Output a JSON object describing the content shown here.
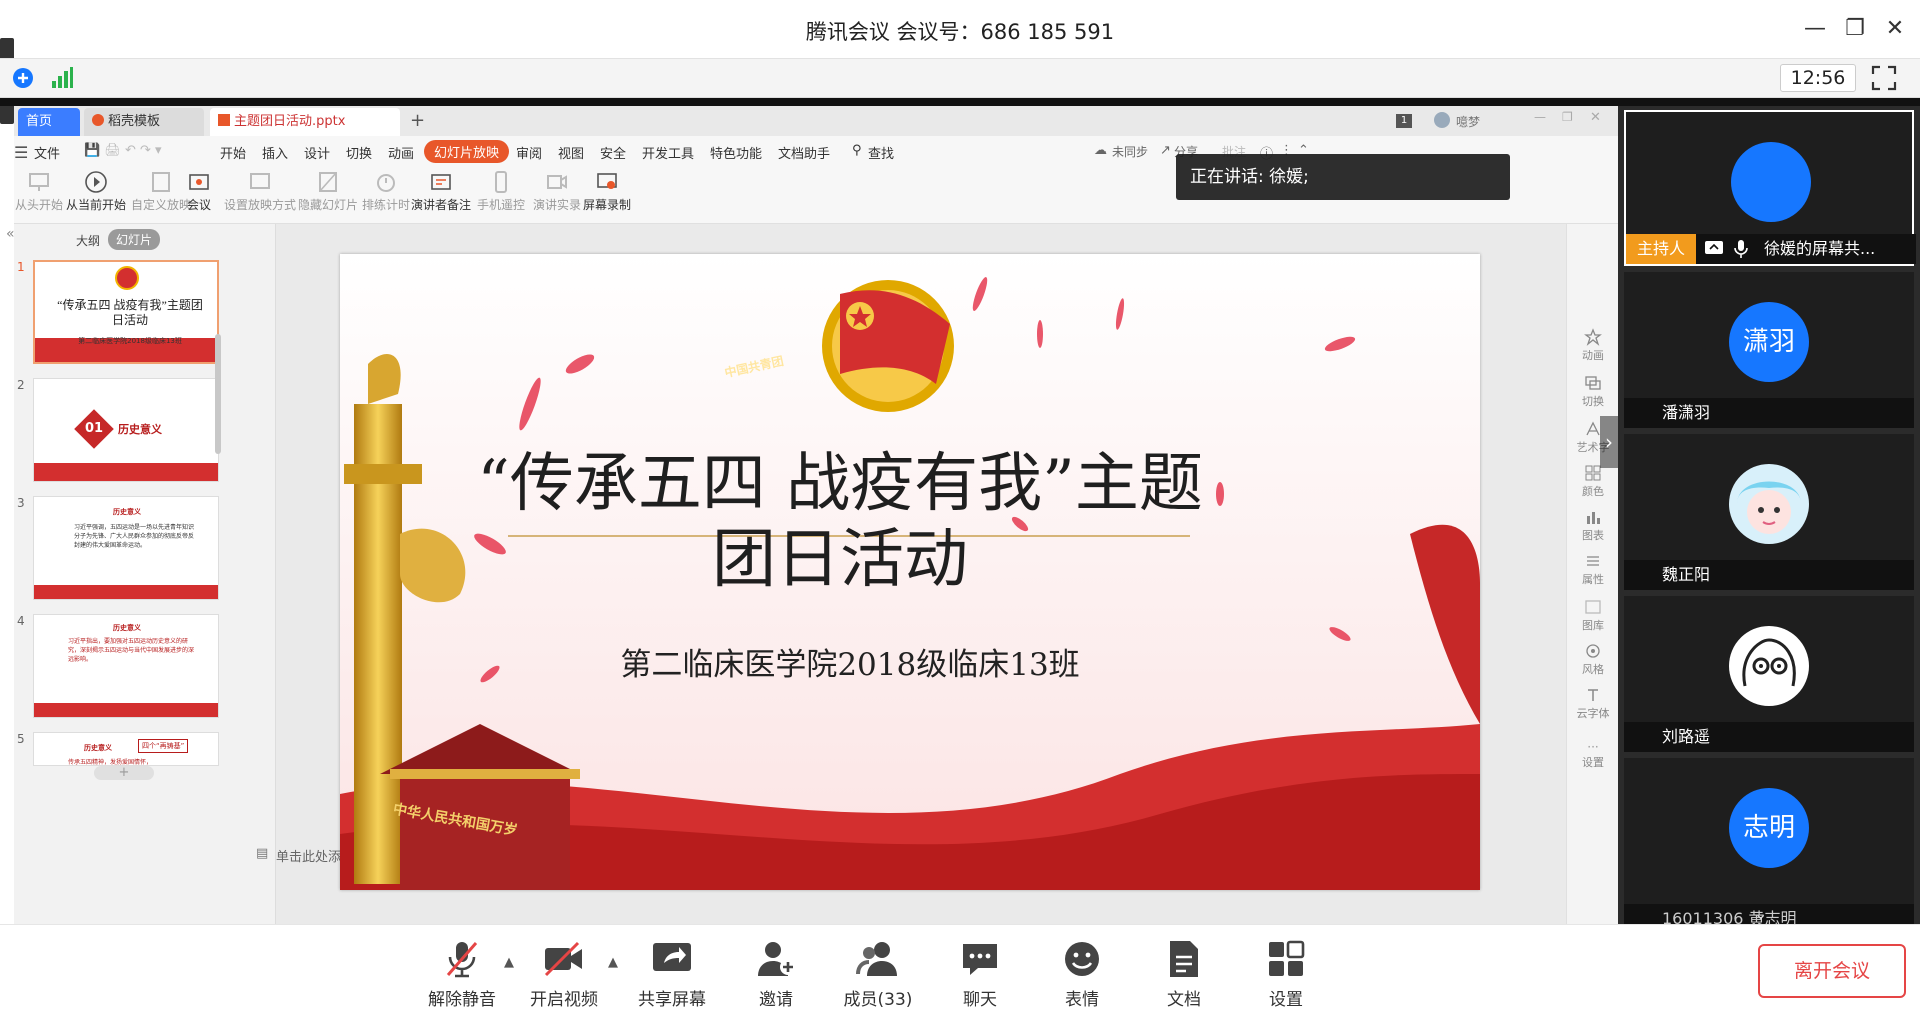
{
  "window": {
    "title": "腾讯会议 会议号：686 185 591",
    "clock": "12:56"
  },
  "wps": {
    "tabs": [
      {
        "label": "首页"
      },
      {
        "label": "稻壳模板"
      },
      {
        "label": "主题团日活动.pptx"
      }
    ],
    "user": "噫梦",
    "page_badge": "1",
    "menu": {
      "file": "文件",
      "items": [
        "开始",
        "插入",
        "设计",
        "切换",
        "动画",
        "幻灯片放映",
        "审阅",
        "视图",
        "安全",
        "开发工具",
        "特色功能",
        "文档助手"
      ],
      "active": "幻灯片放映",
      "search": "查找",
      "sync": "未同步",
      "share": "分享",
      "annotate": "批注"
    },
    "ribbon": [
      "从头开始",
      "从当前开始",
      "自定义放映",
      "会议",
      "设置放映方式",
      "隐藏幻灯片",
      "排练计时",
      "演讲者备注",
      "手机遥控",
      "演讲实录",
      "屏幕录制"
    ],
    "pane_tabs": {
      "outline": "大纲",
      "slides": "幻灯片"
    },
    "thumbs": [
      {
        "num": "1",
        "title": "“传承五四 战疫有我”主题团日活动",
        "sub": "第二临床医学院2018级临床13班"
      },
      {
        "num": "2",
        "badge": "01",
        "title": "历史意义"
      },
      {
        "num": "3",
        "title": "历史意义",
        "body": "习近平强调，五四运动是一场以先进青年知识分子为先锋、广大人民群众参加的彻底反帝反封建的伟大爱国革命运动。"
      },
      {
        "num": "4",
        "title": "历史意义",
        "body": "习近平指出，要加强对五四运动历史意义的研究，深刻揭示五四运动与当代中国发展进步的深远影响。"
      },
      {
        "num": "5",
        "title": "历史意义",
        "tag": "四个“再铸基”",
        "body": "传承五四精神，发扬爱国情怀，"
      }
    ],
    "slide": {
      "title": "“传承五四  战疫有我”主题团日活动",
      "subtitle": "第二临床医学院2018级临床13班",
      "badge_text": "中国共青团",
      "gate_text": "中华人民共和国万岁"
    },
    "notes": "单击此处添加备注",
    "right_panel": [
      "动画",
      "切换",
      "艺术字",
      "颜色",
      "图表",
      "属性",
      "图库",
      "风格",
      "云字体",
      "设置"
    ]
  },
  "speaking": {
    "label": "正在讲话: 徐媛;"
  },
  "participants": [
    {
      "avatar": "",
      "name": "徐媛的屏幕共...",
      "role": "主持人",
      "sharing": true
    },
    {
      "avatar": "潇羽",
      "name": "潘潇羽"
    },
    {
      "avatar": "",
      "name": "魏正阳"
    },
    {
      "avatar": "",
      "name": "刘路遥"
    },
    {
      "avatar": "志明",
      "name": "16011306 黄志明"
    }
  ],
  "toolbar": {
    "mute": "解除静音",
    "video": "开启视频",
    "share": "共享屏幕",
    "invite": "邀请",
    "members": "成员(33)",
    "chat": "聊天",
    "emoji": "表情",
    "doc": "文档",
    "settings": "设置",
    "leave": "离开会议"
  },
  "colors": {
    "accent": "#1677ff",
    "brand_red": "#d32f2f",
    "leave_red": "#e54545",
    "wps_tab_orange": "#e8572a"
  }
}
